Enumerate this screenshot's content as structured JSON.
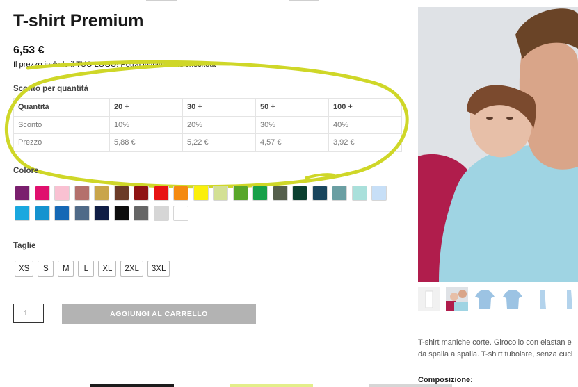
{
  "product": {
    "title": "T-shirt Premium",
    "price": "6,53 €",
    "price_note": "Il prezzo include il TUO LOGO! Potrai inviarcelo al checkout"
  },
  "discount": {
    "label": "Sconto per quantità",
    "rows": [
      [
        "Quantità",
        "20 +",
        "30 +",
        "50 +",
        "100 +"
      ],
      [
        "Sconto",
        "10%",
        "20%",
        "30%",
        "40%"
      ],
      [
        "Prezzo",
        "5,88 €",
        "5,22 €",
        "4,57 €",
        "3,92 €"
      ]
    ],
    "highlight_color": "#cfd728"
  },
  "colors": {
    "label": "Colore",
    "swatches": [
      "#7a1f6e",
      "#e0106e",
      "#f9c1d2",
      "#b4706c",
      "#c9a54a",
      "#6b3b27",
      "#8f1414",
      "#e81313",
      "#f58a0f",
      "#fbef0a",
      "#d3e094",
      "#58a62a",
      "#17a049",
      "#555f4c",
      "#0b4030",
      "#19465e",
      "#6a9fa3",
      "#a9e0db",
      "#c7dff7",
      "#1aa8df",
      "#1593cf",
      "#1568b5",
      "#4f6a88",
      "#0f1d45",
      "#0d0d0d",
      "#666666",
      "#d6d6d6",
      "#ffffff"
    ]
  },
  "sizes": {
    "label": "Taglie",
    "options": [
      "XS",
      "S",
      "M",
      "L",
      "XL",
      "2XL",
      "3XL"
    ]
  },
  "cart": {
    "quantity": "1",
    "add_label": "AGGIUNGI AL CARRELLO"
  },
  "description": {
    "line1": "T-shirt maniche corte. Girocollo con elastan e",
    "line2": "da spalla a spalla. T-shirt tubolare, senza cuci",
    "composition_label": "Composizione:"
  }
}
